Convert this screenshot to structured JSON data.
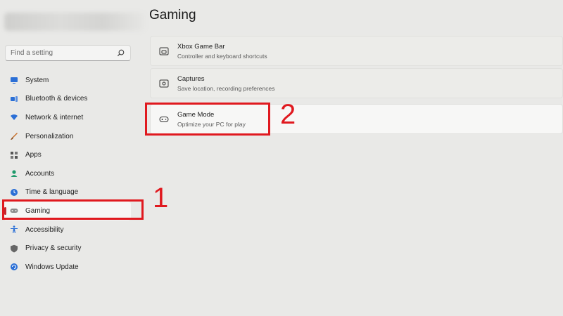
{
  "page": {
    "title": "Gaming"
  },
  "search": {
    "placeholder": "Find a setting"
  },
  "sidebar": {
    "items": [
      {
        "label": "System",
        "icon": "monitor-icon",
        "color": "#2b6fd6"
      },
      {
        "label": "Bluetooth & devices",
        "icon": "bluetooth-icon",
        "color": "#2b6fd6"
      },
      {
        "label": "Network & internet",
        "icon": "wifi-icon",
        "color": "#2b6fd6"
      },
      {
        "label": "Personalization",
        "icon": "brush-icon",
        "color": "#c8702a"
      },
      {
        "label": "Apps",
        "icon": "apps-icon",
        "color": "#555555"
      },
      {
        "label": "Accounts",
        "icon": "person-icon",
        "color": "#1f9a6b"
      },
      {
        "label": "Time & language",
        "icon": "globe-clock-icon",
        "color": "#2b6fd6"
      },
      {
        "label": "Gaming",
        "icon": "controller-icon",
        "color": "#6d6d6d",
        "selected": true
      },
      {
        "label": "Accessibility",
        "icon": "accessibility-icon",
        "color": "#2b6fd6"
      },
      {
        "label": "Privacy & security",
        "icon": "shield-icon",
        "color": "#666666"
      },
      {
        "label": "Windows Update",
        "icon": "update-icon",
        "color": "#2b6fd6"
      }
    ]
  },
  "cards": [
    {
      "title": "Xbox Game Bar",
      "subtitle": "Controller and keyboard shortcuts",
      "icon": "game-bar-icon"
    },
    {
      "title": "Captures",
      "subtitle": "Save location, recording preferences",
      "icon": "capture-icon"
    },
    {
      "title": "Game Mode",
      "subtitle": "Optimize your PC for play",
      "icon": "controller-icon"
    }
  ],
  "annotations": {
    "step1": "1",
    "step2": "2",
    "accent": "#e0191f"
  }
}
